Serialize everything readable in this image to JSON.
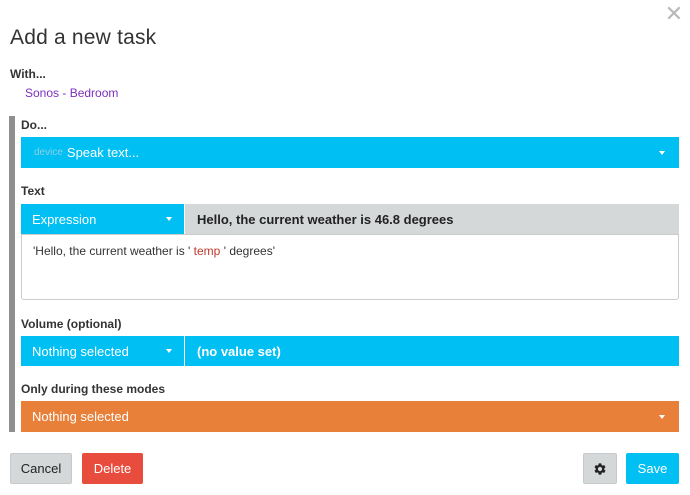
{
  "dialog": {
    "close_glyph": "✕",
    "title": "Add a new task"
  },
  "with": {
    "label": "With...",
    "device": "Sonos - Bedroom"
  },
  "do": {
    "label": "Do...",
    "prefix": "device",
    "selected": "Speak text..."
  },
  "text_param": {
    "label": "Text",
    "mode": "Expression",
    "evaluated": "Hello, the current weather is 46.8 degrees",
    "expression_before": "'Hello, the current weather is '",
    "expression_var": "temp",
    "expression_after": "' degrees'"
  },
  "volume_param": {
    "label": "Volume (optional)",
    "mode": "Nothing selected",
    "value": "(no value set)"
  },
  "modes_param": {
    "label": "Only during these modes",
    "selected": "Nothing selected"
  },
  "buttons": {
    "cancel": "Cancel",
    "delete": "Delete",
    "save": "Save"
  },
  "colors": {
    "primary": "#00bff3",
    "danger": "#e74c3c",
    "warning": "#e8803a",
    "neutral": "#d5d8d9",
    "link": "#7b2fbf"
  },
  "icons": {
    "close": "close-icon",
    "caret": "caret-down-icon",
    "settings": "gear-icon"
  }
}
